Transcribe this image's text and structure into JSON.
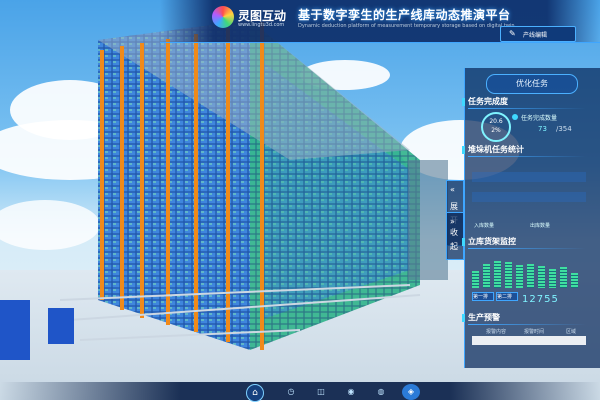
{
  "header": {
    "brand_name": "灵图互动",
    "brand_url": "www.lingtu3d.com",
    "title": "基于数字孪生的生产线库动态推演平台",
    "subtitle": "Dynamic deduction platform of measurement temporary storage based on digital twin",
    "edit_button_label": "产线编辑",
    "edit_icon": "edit-icon"
  },
  "panel": {
    "title": "优化任务",
    "completion": {
      "section_title": "任务完成度",
      "percent_value": "20.6",
      "percent_unit": "2%",
      "count_label": "任务完成数量",
      "done": "73",
      "total": "/354"
    },
    "stacker": {
      "section_title": "堆垛机任务统计",
      "label_in": "入库数量",
      "label_out": "出库数量"
    },
    "shelf": {
      "section_title": "立库货架监控",
      "levels": [
        0.55,
        0.8,
        0.9,
        0.85,
        0.75,
        0.8,
        0.72,
        0.62,
        0.7,
        0.5
      ],
      "btn_a": "第一排",
      "btn_b": "第二排",
      "count": "12755"
    },
    "warning": {
      "section_title": "生产预警",
      "col1": "报警内容",
      "col2": "报警时间",
      "col3": "区域"
    }
  },
  "side_tabs": [
    {
      "arrow": "«",
      "text1": "展",
      "text2": "开"
    },
    {
      "arrow": "»",
      "text1": "收",
      "text2": "起"
    }
  ],
  "bottom_nav": {
    "home_icon": "home-icon",
    "items": [
      {
        "icon": "factory-icon",
        "glyph": "◷",
        "active": false
      },
      {
        "icon": "warehouse-icon",
        "glyph": "◫",
        "active": false
      },
      {
        "icon": "robot-icon",
        "glyph": "◉",
        "active": false
      },
      {
        "icon": "conveyor-icon",
        "glyph": "◍",
        "active": false
      },
      {
        "icon": "chart-icon",
        "glyph": "◈",
        "active": true
      }
    ]
  },
  "colors": {
    "accent": "#3fa6ff",
    "rack_blue": "#2d6fd0",
    "rack_green": "#2fb38a",
    "pillar_orange": "#f08a1a"
  }
}
